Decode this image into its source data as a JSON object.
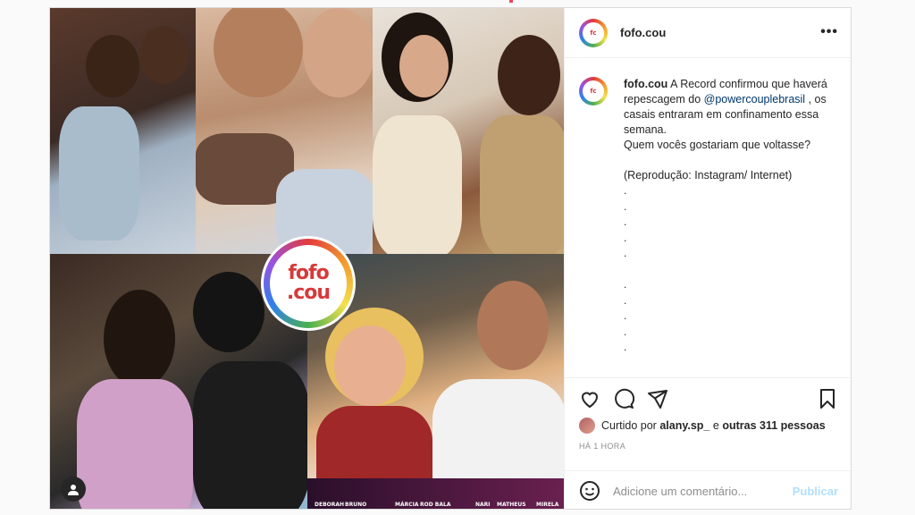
{
  "post": {
    "username": "fofo.cou",
    "more_label": "•••",
    "logo_text_1": "fofo",
    "logo_text_2": ".cou",
    "caption": {
      "username": "fofo.cou",
      "text_1": " A Record confirmou que haverá repescagem do ",
      "mention": "@powercouplebrasil",
      "text_2": " , os casais entraram em confinamento essa semana.",
      "line_2": "Quem vocês gostariam que voltasse?",
      "line_3": "(Reprodução: Instagram/ Internet)",
      "dots": [
        ".",
        ".",
        ".",
        ".",
        ".",
        "",
        ".",
        ".",
        ".",
        ".",
        "."
      ]
    },
    "likes": {
      "prefix": "Curtido por ",
      "user": "alany.sp_",
      "middle": " e ",
      "others": "outras 311 pessoas"
    },
    "time": "HÁ 1 HORA",
    "comment": {
      "placeholder": "Adicione um comentário...",
      "publish_label": "Publicar"
    },
    "couple_tags": [
      "DEBORAH",
      "BRUNO",
      "MÁRCIA",
      "ROD BALA",
      "NARI",
      "MATHEUS",
      "MIRELA"
    ]
  },
  "colors": {
    "accent": "#0095f6",
    "publish_disabled": "#b2dffc",
    "mention": "#00376b",
    "muted": "#8e8e8e"
  },
  "icons": [
    "more-icon",
    "heart-icon",
    "comment-icon",
    "share-icon",
    "bookmark-icon",
    "emoji-icon",
    "user-tag-icon"
  ]
}
